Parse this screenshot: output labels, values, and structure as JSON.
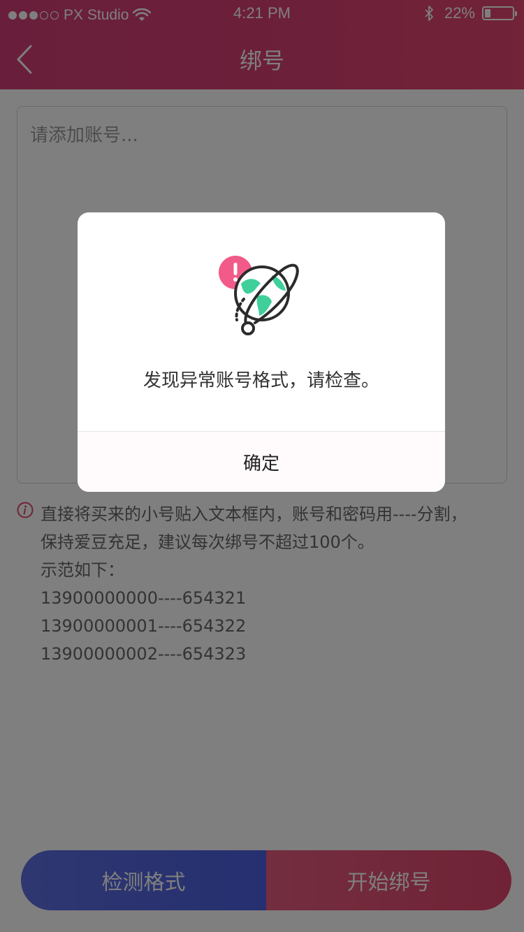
{
  "status_bar": {
    "carrier": "PX Studio",
    "time": "4:21 PM",
    "battery_text": "22%",
    "battery_level": 0.22
  },
  "nav": {
    "title": "绑号",
    "back_icon": "chevron-left-icon"
  },
  "textarea": {
    "placeholder": "请添加账号..."
  },
  "hint": {
    "icon": "info-icon",
    "lines": [
      "直接将买来的小号贴入文本框内，账号和密码用----分割，",
      "保持爱豆充足，建议每次绑号不超过100个。",
      "示范如下：",
      "13900000000----654321",
      "13900000001----654322",
      "13900000002----654323"
    ]
  },
  "buttons": {
    "check_format": "检测格式",
    "start_binding": "开始绑号"
  },
  "modal": {
    "icon": "globe-warning-icon",
    "message": "发现异常账号格式，请检查。",
    "confirm": "确定"
  },
  "colors": {
    "brand_pink": "#e0466c",
    "brand_blue": "#4d5fe0",
    "warning_pink": "#f25a8a",
    "globe_green": "#3ecf9a"
  }
}
